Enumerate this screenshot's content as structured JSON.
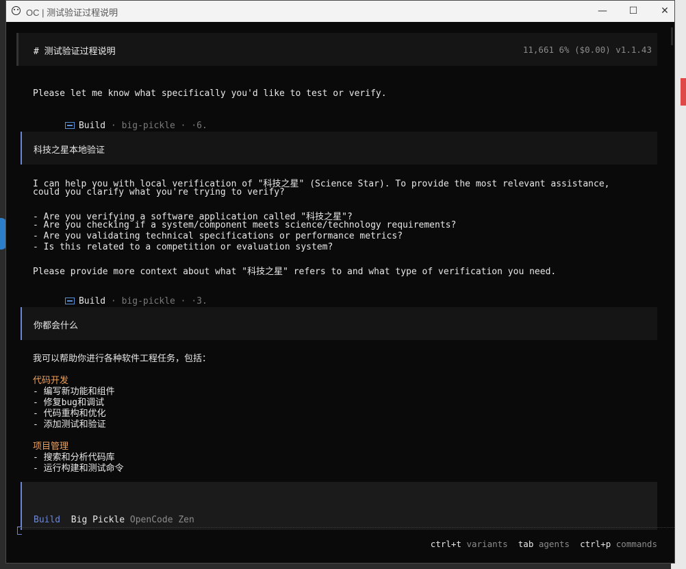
{
  "window": {
    "title": "OC | 测试验证过程说明",
    "minimize": "—",
    "maximize": "☐",
    "close": "✕"
  },
  "header": {
    "title": "# 测试验证过程说明",
    "stats": "11,661  6% ($0.00) v1.1.43"
  },
  "messages": [
    {
      "role": "assistant",
      "lines": [
        "Please let me know what specifically you'd like to test or verify."
      ],
      "meta": {
        "mode": "Build",
        "model": " · big-pickle · ·6."
      }
    },
    {
      "role": "user",
      "text": "科技之星本地验证"
    },
    {
      "role": "assistant",
      "lines": [
        "I can help you with local verification of \"科技之星\" (Science Star). To provide the most relevant assistance,",
        "could you clarify what you're trying to verify?",
        "",
        "- Are you verifying a software application called \"科技之星\"?",
        "- Are you checking if a system/component meets science/technology requirements?",
        "- Are you validating technical specifications or performance metrics?",
        "- Is this related to a competition or evaluation system?",
        "",
        "Please provide more context about what \"科技之星\" refers to and what type of verification you need."
      ],
      "meta": {
        "mode": "Build",
        "model": " · big-pickle · ·3."
      }
    },
    {
      "role": "user",
      "text": "你都会什么"
    },
    {
      "role": "assistant",
      "intro": "我可以帮助你进行各种软件工程任务，包括：",
      "sections": [
        {
          "heading": "代码开发",
          "items": [
            "- 编写新功能和组件",
            "- 修复bug和调试",
            "- 代码重构和优化",
            "- 添加测试和验证"
          ]
        },
        {
          "heading": "项目管理",
          "items": [
            "- 搜索和分析代码库",
            "- 运行构建和测试命令"
          ]
        }
      ]
    }
  ],
  "input": {
    "mode": "Build",
    "model": "Big Pickle",
    "provider": "OpenCode Zen"
  },
  "footer": {
    "k1": "ctrl+t",
    "d1": "variants",
    "k2": "tab",
    "d2": "agents",
    "k3": "ctrl+p",
    "d3": "commands"
  },
  "colors": {
    "accent_blue": "#6d87d6",
    "heading_orange": "#f0a05a",
    "background": "#0a0a0a"
  }
}
